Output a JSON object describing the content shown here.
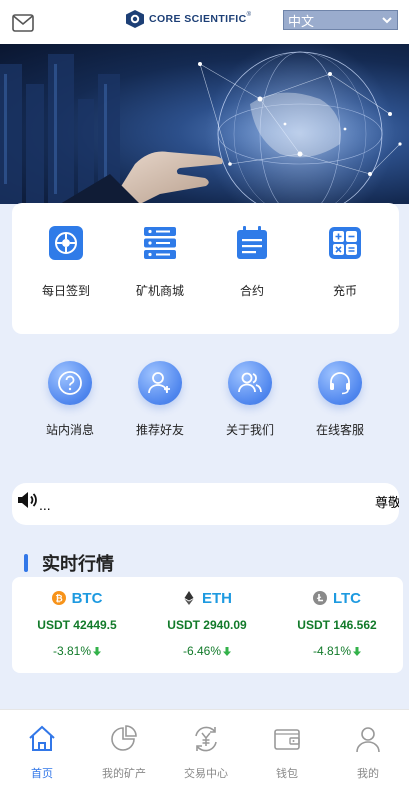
{
  "header": {
    "logo_text": "CORE SCIENTIFIC",
    "logo_mark": "®",
    "language": "中文"
  },
  "quick_actions": [
    {
      "label": "每日签到",
      "icon": "sign-in-icon"
    },
    {
      "label": "矿机商城",
      "icon": "server-icon"
    },
    {
      "label": "合约",
      "icon": "contract-icon"
    },
    {
      "label": "充币",
      "icon": "calculator-icon"
    }
  ],
  "info_links": [
    {
      "label": "站内消息",
      "icon": "question-icon"
    },
    {
      "label": "推荐好友",
      "icon": "add-friend-icon"
    },
    {
      "label": "关于我们",
      "icon": "users-icon"
    },
    {
      "label": "在线客服",
      "icon": "headset-icon"
    }
  ],
  "notice": {
    "dots": "...",
    "text": "尊敬"
  },
  "market": {
    "title": "实时行情",
    "coins": [
      {
        "symbol": "BTC",
        "price": "USDT 42449.5",
        "change": "-3.81%",
        "icon_color": "#f7931a"
      },
      {
        "symbol": "ETH",
        "price": "USDT 2940.09",
        "change": "-6.46%",
        "icon_color": "#333333"
      },
      {
        "symbol": "LTC",
        "price": "USDT 146.562",
        "change": "-4.81%",
        "icon_color": "#8a8a8a"
      }
    ]
  },
  "tabbar": [
    {
      "label": "首页",
      "active": true
    },
    {
      "label": "我的矿产",
      "active": false
    },
    {
      "label": "交易中心",
      "active": false
    },
    {
      "label": "钱包",
      "active": false
    },
    {
      "label": "我的",
      "active": false
    }
  ],
  "colors": {
    "accent": "#3277e8",
    "up_down_green": "#127a2a",
    "coin_name": "#1e9ae0",
    "page_bg": "#e8eefa"
  }
}
